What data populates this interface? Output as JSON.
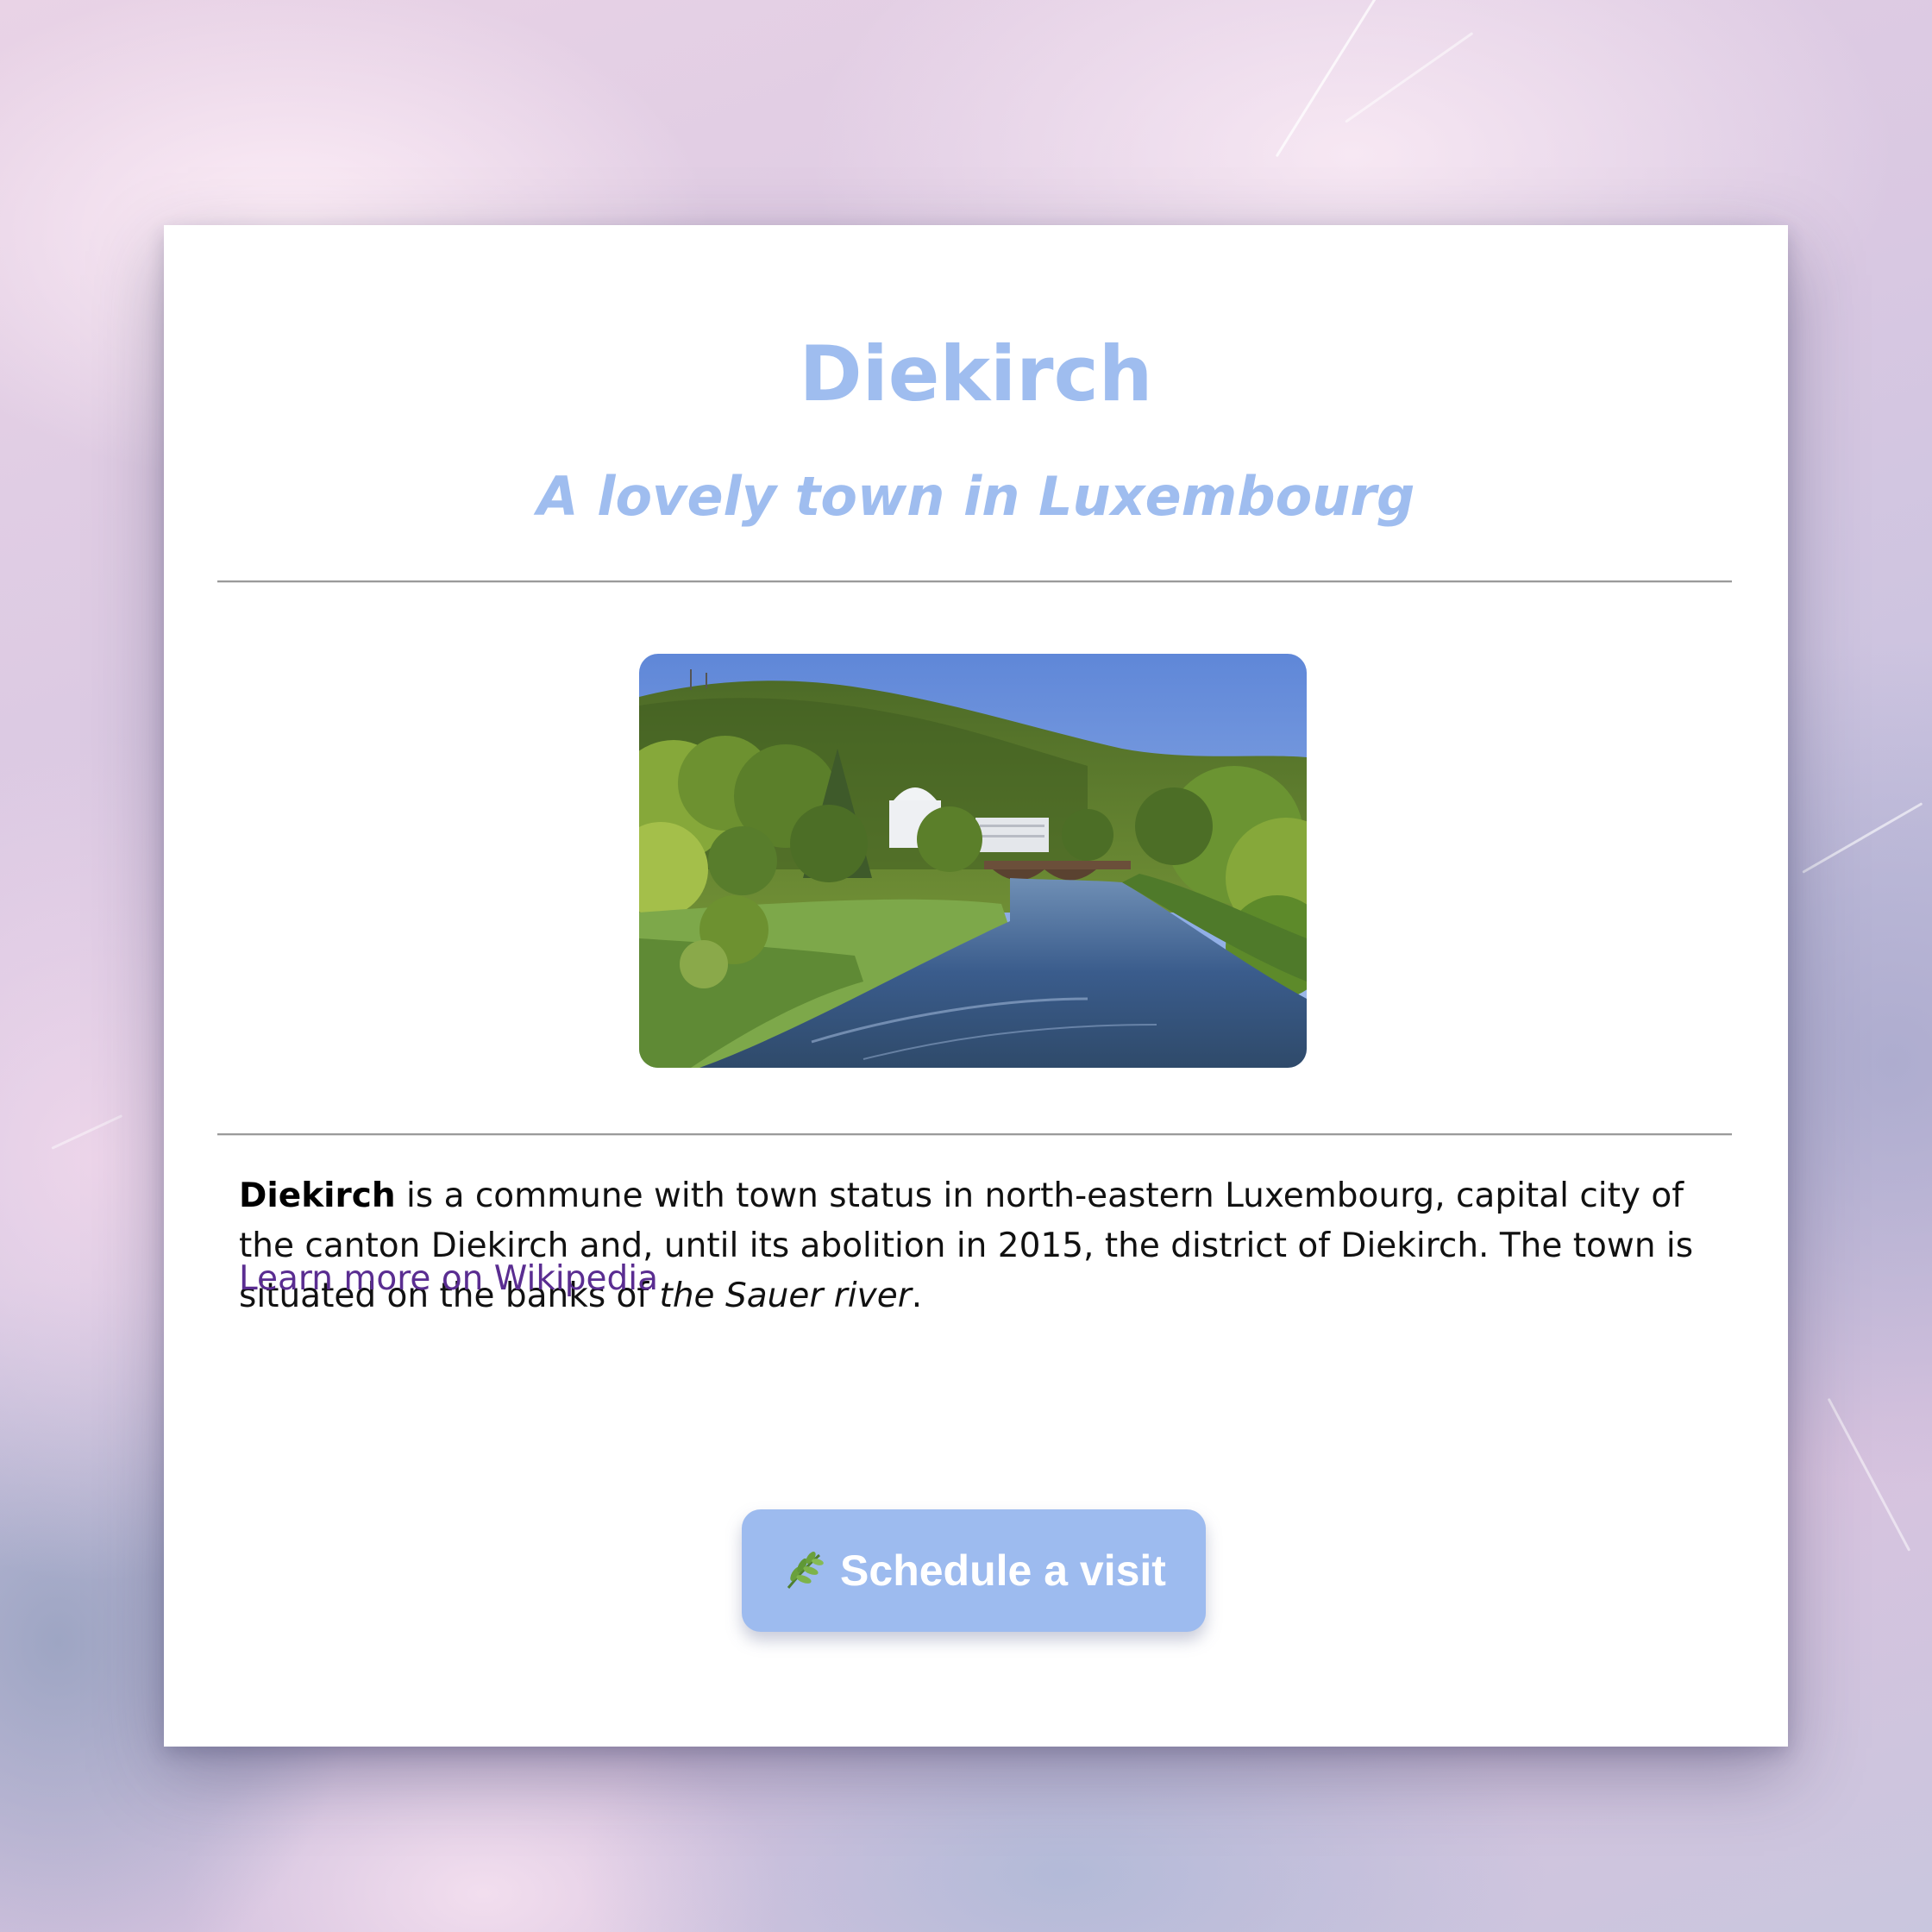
{
  "header": {
    "title": "Diekirch",
    "subtitle": "A lovely town in Luxembourg"
  },
  "image": {
    "icon": "river-landscape-photo"
  },
  "description": {
    "bold_name": "Diekirch",
    "text_before_italic": " is a commune with town status in north-eastern Luxembourg, capital city of the canton Diekirch and, until its abolition in 2015, the district of Diekirch. The town is situated on the banks of ",
    "italic_text": "the Sauer river",
    "text_after_italic": "."
  },
  "link": {
    "label": "Learn more on Wikipedia"
  },
  "cta": {
    "icon": "herb-leaf-icon",
    "label": "Schedule a visit"
  },
  "colors": {
    "accent": "#9fbdef",
    "button": "#9dbbef",
    "link": "#5a2d91",
    "card": "#ffffff"
  }
}
